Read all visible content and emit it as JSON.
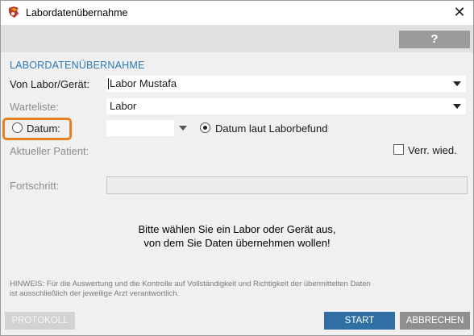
{
  "window": {
    "title": "Labordatenübernahme",
    "close_label": "✕"
  },
  "toolbar": {
    "help_label": "?"
  },
  "section": {
    "title": "LABORDATENÜBERNAHME"
  },
  "form": {
    "von_label": "Von Labor/Gerät:",
    "von_value": "Labor Mustafa",
    "warteliste_label": "Warteliste:",
    "warteliste_value": "Labor",
    "datum_label": "Datum:",
    "datum_value": "",
    "datum_laut_label": "Datum laut Laborbefund",
    "aktueller_patient_label": "Aktueller Patient:",
    "verr_wied_label": "Verr. wied.",
    "verr_wied_checked": false,
    "fortschritt_label": "Fortschritt:",
    "progress": 0
  },
  "message": {
    "line1": "Bitte wählen Sie ein Labor oder Gerät aus,",
    "line2": "von dem Sie Daten übernehmen wollen!"
  },
  "hint": {
    "line1": "HINWEIS: Für die Auswertung und die Kontrolle auf Vollständigkeit und Richtigkeit der übermittelten Daten",
    "line2": "ist ausschließlich der jeweilige Arzt verantwortlich."
  },
  "buttons": {
    "protokoll": "PROTOKOLL",
    "start": "START",
    "abbrechen": "ABBRECHEN"
  },
  "colors": {
    "accent": "#2b79b6",
    "highlight": "#e57f22",
    "start_button": "#2f6fa3",
    "cancel_button": "#8f8f8f"
  }
}
